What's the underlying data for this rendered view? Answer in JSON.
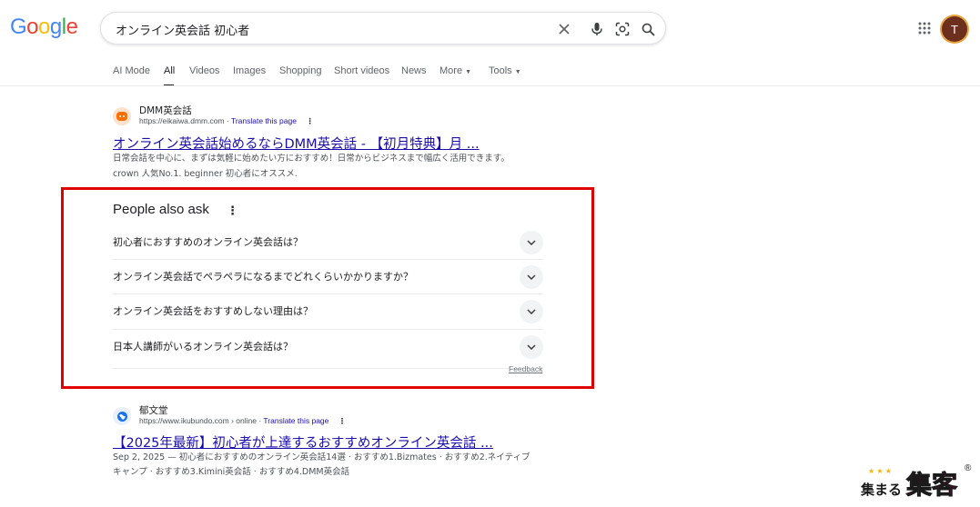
{
  "logo": {
    "letters": [
      "G",
      "o",
      "o",
      "g",
      "l",
      "e"
    ],
    "colors": [
      "#4285f4",
      "#ea4335",
      "#fbbc05",
      "#4285f4",
      "#34a853",
      "#ea4335"
    ]
  },
  "search": {
    "value": "オンライン英会話 初心者"
  },
  "icons": {
    "clear": "close-icon",
    "voice": "mic-icon",
    "lens": "lens-icon",
    "search": "search-icon",
    "apps": "apps-grid-icon"
  },
  "account": {
    "initial": "T"
  },
  "tabs": [
    {
      "label": "AI Mode"
    },
    {
      "label": "All",
      "active": true
    },
    {
      "label": "Videos"
    },
    {
      "label": "Images"
    },
    {
      "label": "Shopping"
    },
    {
      "label": "Short videos"
    },
    {
      "label": "News"
    },
    {
      "label": "More"
    },
    {
      "label": "Tools"
    }
  ],
  "results": [
    {
      "site_name": "DMM英会話",
      "url": "https://eikaiwa.dmm.com",
      "translate": "Translate this page",
      "title": "オンライン英会話始めるならDMM英会話 - 【初月特典】月 ...",
      "snippet_1": "日常会話を中心に、まずは気軽に始めたい方におすすめ！日常からビジネスまで幅広く活用できます。",
      "snippet_2": "crown 人気No.1. beginner 初心者にオススメ."
    },
    {
      "site_name": "郁文堂",
      "url": "https://www.ikubundo.com › online",
      "translate": "Translate this page",
      "title": "【2025年最新】初心者が上達するおすすめオンライン英会話 ...",
      "snippet_1": "Sep 2, 2025 — 初心者におすすめのオンライン英会話14選 · おすすめ1.Bizmates · おすすめ2.ネイティブ",
      "snippet_2": "キャンプ · おすすめ3.Kimini英会話 · おすすめ4.DMM英会話"
    }
  ],
  "paa": {
    "title": "People also ask",
    "questions": [
      "初心者におすすめのオンライン英会話は？",
      "オンライン英会話でペラペラになるまでどれくらいかかりますか？",
      "オンライン英会話をおすすめしない理由は？",
      "日本人講師がいるオンライン英会話は？"
    ],
    "feedback": "Feedback",
    "highlight_color": "#e00000"
  },
  "watermark": {
    "text_small": "集まる",
    "text_big": "集客",
    "mark": "®"
  }
}
